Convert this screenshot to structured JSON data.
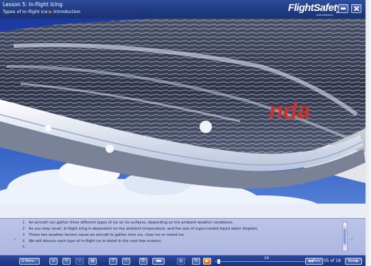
{
  "header": {
    "lesson_title": "Lesson 5: In-flight Icing",
    "breadcrumb": [
      "Types of In-flight Ice",
      "Introduction"
    ],
    "brand": "FlightSafety",
    "brand_sub": "international",
    "accent_color": "#f28a1a",
    "window_buttons": [
      "minimize-icon",
      "close-icon"
    ]
  },
  "scene": {
    "aircraft_livery_fragment": "nda",
    "description_colors": {
      "sky": "#1f3f9c",
      "ice": "#dfe6f3",
      "fuselage": "#f1f2f3",
      "stripe": "#c8342c"
    }
  },
  "transcript": {
    "lines": [
      {
        "num": "1",
        "text": "An aircraft can gather three different types of ice on its surfaces, depending on the ambient weather conditions."
      },
      {
        "num": "2",
        "text": "As you may recall, in-flight icing is dependent on the ambient temperature, and the size of super-cooled liquid water droplets."
      },
      {
        "num": "3",
        "text": "These two weather factors cause an aircraft to gather rime ice, clear ice or mixed ice."
      },
      {
        "num": "4",
        "text": "We will discuss each type of in-flight ice in detail in the next few screens."
      },
      {
        "num": "5",
        "text": ""
      }
    ]
  },
  "toolbar": {
    "menu_label": "Menu",
    "position_count": "19",
    "prev_label": "Prev",
    "next_label": "Next",
    "page_current": "05",
    "page_of": "of",
    "page_total": "18",
    "icons": [
      "home-icon",
      "bookmark-icon",
      "glossary-icon",
      "print-icon",
      "help-icon",
      "info-icon",
      "resources-icon",
      "audio-icon",
      "stop-icon",
      "replay-icon",
      "play-icon"
    ]
  }
}
